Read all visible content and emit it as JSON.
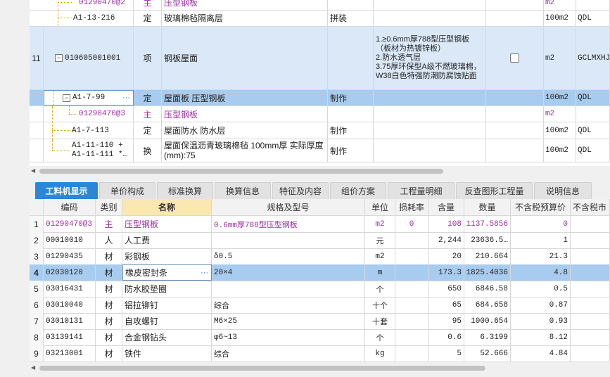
{
  "top_rows": [
    {
      "num": "",
      "code": "01290470@2",
      "type": "主",
      "name": "压型钢板",
      "sub": "",
      "features": "",
      "unit": "m2",
      "extra": "",
      "purple": true
    },
    {
      "num": "",
      "code": "A1-13-216",
      "type": "定",
      "name": "玻璃棉毡隔离层",
      "sub": "拼装",
      "features": "",
      "unit": "100m2",
      "extra": "QDL",
      "purple": false
    },
    {
      "num": "11",
      "code": "010605001001",
      "type": "项",
      "name": "钢板屋面",
      "sub": "",
      "features": "1.≥0.6mm厚788型压型钢板（板材为热镀锌板）\n2.防水透气层\n3.75厚环保型A级不燃玻璃棉，W38白色特强防潮防腐蚀贴面",
      "unit": "m2",
      "extra": "GCLMXHJ",
      "purple": false
    },
    {
      "num": "",
      "code": "A1-7-99",
      "type": "定",
      "name": "屋面板 压型钢板",
      "sub": "制作",
      "features": "",
      "unit": "100m2",
      "extra": "QDL",
      "purple": false
    },
    {
      "num": "",
      "code": "01290470@3",
      "type": "主",
      "name": "压型钢板",
      "sub": "",
      "features": "",
      "unit": "m2",
      "extra": "",
      "purple": true
    },
    {
      "num": "",
      "code": "A1-7-113",
      "type": "定",
      "name": "屋面防水 防水层",
      "sub": "制作",
      "features": "",
      "unit": "100m2",
      "extra": "QDL",
      "purple": false
    },
    {
      "num": "",
      "code": "A1-11-110 + A1-11-111 *…",
      "type": "换",
      "name": "屋面保温沥青玻璃棉毡 100mm厚  实际厚度(mm):75",
      "sub": "制作",
      "features": "",
      "unit": "100m2",
      "extra": "QDL",
      "purple": false
    }
  ],
  "tabs": [
    "工料机显示",
    "单价构成",
    "标准换算",
    "换算信息",
    "特征及内容",
    "组价方案",
    "工程量明细",
    "反查图形工程量",
    "说明信息"
  ],
  "columns": [
    "编码",
    "类别",
    "名称",
    "规格及型号",
    "单位",
    "损耗率",
    "含量",
    "数量",
    "不含税预算价",
    "不含税市"
  ],
  "rows": [
    {
      "idx": "1",
      "code": "01290470@3",
      "cat": "主",
      "name": "压型钢板",
      "spec": "0.6mm厚788型压型钢板",
      "unit": "m2",
      "loss": "0",
      "qty": "108",
      "amount": "1137.5856",
      "price": "0",
      "purple": true
    },
    {
      "idx": "2",
      "code": "00010010",
      "cat": "人",
      "name": "人工费",
      "spec": "",
      "unit": "元",
      "loss": "",
      "qty": "2,244",
      "amount": "23636.5…",
      "price": "1",
      "purple": false
    },
    {
      "idx": "3",
      "code": "01290435",
      "cat": "材",
      "name": "彩钢板",
      "spec": "δ0.5",
      "unit": "m2",
      "loss": "",
      "qty": "20",
      "amount": "210.664",
      "price": "21.3",
      "purple": false
    },
    {
      "idx": "4",
      "code": "02030120",
      "cat": "材",
      "name": "橡皮密封条",
      "spec": "20×4",
      "unit": "m",
      "loss": "",
      "qty": "173.3",
      "amount": "1825.4036",
      "price": "4.8",
      "purple": false
    },
    {
      "idx": "5",
      "code": "03016431",
      "cat": "材",
      "name": "防水胶垫圈",
      "spec": "",
      "unit": "个",
      "loss": "",
      "qty": "650",
      "amount": "6846.58",
      "price": "0.5",
      "purple": false
    },
    {
      "idx": "6",
      "code": "03010040",
      "cat": "材",
      "name": "铝拉铆钉",
      "spec": "综合",
      "unit": "十个",
      "loss": "",
      "qty": "65",
      "amount": "684.658",
      "price": "0.87",
      "purple": false
    },
    {
      "idx": "7",
      "code": "03010131",
      "cat": "材",
      "name": "自攻螺钉",
      "spec": "M6×25",
      "unit": "十套",
      "loss": "",
      "qty": "95",
      "amount": "1000.654",
      "price": "0.93",
      "purple": false
    },
    {
      "idx": "8",
      "code": "03139141",
      "cat": "材",
      "name": "合金钢钻头",
      "spec": "φ6~13",
      "unit": "个",
      "loss": "",
      "qty": "0.6",
      "amount": "6.3199",
      "price": "8.12",
      "purple": false
    },
    {
      "idx": "9",
      "code": "03213001",
      "cat": "材",
      "name": "铁件",
      "spec": "综合",
      "unit": "kg",
      "loss": "",
      "qty": "5",
      "amount": "52.666",
      "price": "4.84",
      "purple": false
    }
  ]
}
